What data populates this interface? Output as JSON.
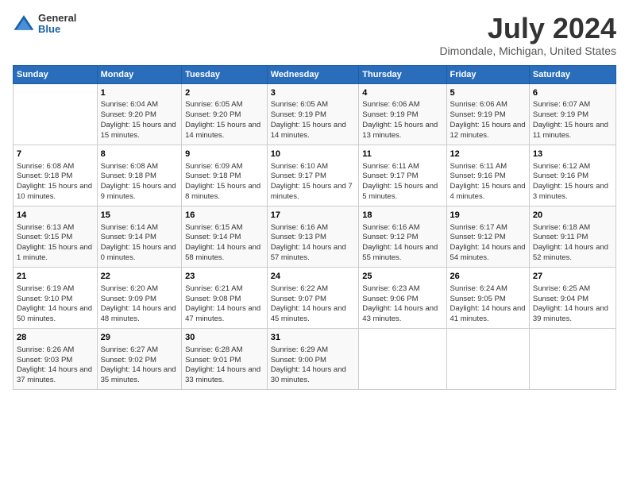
{
  "logo": {
    "general": "General",
    "blue": "Blue"
  },
  "title": "July 2024",
  "subtitle": "Dimondale, Michigan, United States",
  "days_header": [
    "Sunday",
    "Monday",
    "Tuesday",
    "Wednesday",
    "Thursday",
    "Friday",
    "Saturday"
  ],
  "weeks": [
    [
      {
        "day": "",
        "sunrise": "",
        "sunset": "",
        "daylight": ""
      },
      {
        "day": "1",
        "sunrise": "Sunrise: 6:04 AM",
        "sunset": "Sunset: 9:20 PM",
        "daylight": "Daylight: 15 hours and 15 minutes."
      },
      {
        "day": "2",
        "sunrise": "Sunrise: 6:05 AM",
        "sunset": "Sunset: 9:20 PM",
        "daylight": "Daylight: 15 hours and 14 minutes."
      },
      {
        "day": "3",
        "sunrise": "Sunrise: 6:05 AM",
        "sunset": "Sunset: 9:19 PM",
        "daylight": "Daylight: 15 hours and 14 minutes."
      },
      {
        "day": "4",
        "sunrise": "Sunrise: 6:06 AM",
        "sunset": "Sunset: 9:19 PM",
        "daylight": "Daylight: 15 hours and 13 minutes."
      },
      {
        "day": "5",
        "sunrise": "Sunrise: 6:06 AM",
        "sunset": "Sunset: 9:19 PM",
        "daylight": "Daylight: 15 hours and 12 minutes."
      },
      {
        "day": "6",
        "sunrise": "Sunrise: 6:07 AM",
        "sunset": "Sunset: 9:19 PM",
        "daylight": "Daylight: 15 hours and 11 minutes."
      }
    ],
    [
      {
        "day": "7",
        "sunrise": "Sunrise: 6:08 AM",
        "sunset": "Sunset: 9:18 PM",
        "daylight": "Daylight: 15 hours and 10 minutes."
      },
      {
        "day": "8",
        "sunrise": "Sunrise: 6:08 AM",
        "sunset": "Sunset: 9:18 PM",
        "daylight": "Daylight: 15 hours and 9 minutes."
      },
      {
        "day": "9",
        "sunrise": "Sunrise: 6:09 AM",
        "sunset": "Sunset: 9:18 PM",
        "daylight": "Daylight: 15 hours and 8 minutes."
      },
      {
        "day": "10",
        "sunrise": "Sunrise: 6:10 AM",
        "sunset": "Sunset: 9:17 PM",
        "daylight": "Daylight: 15 hours and 7 minutes."
      },
      {
        "day": "11",
        "sunrise": "Sunrise: 6:11 AM",
        "sunset": "Sunset: 9:17 PM",
        "daylight": "Daylight: 15 hours and 5 minutes."
      },
      {
        "day": "12",
        "sunrise": "Sunrise: 6:11 AM",
        "sunset": "Sunset: 9:16 PM",
        "daylight": "Daylight: 15 hours and 4 minutes."
      },
      {
        "day": "13",
        "sunrise": "Sunrise: 6:12 AM",
        "sunset": "Sunset: 9:16 PM",
        "daylight": "Daylight: 15 hours and 3 minutes."
      }
    ],
    [
      {
        "day": "14",
        "sunrise": "Sunrise: 6:13 AM",
        "sunset": "Sunset: 9:15 PM",
        "daylight": "Daylight: 15 hours and 1 minute."
      },
      {
        "day": "15",
        "sunrise": "Sunrise: 6:14 AM",
        "sunset": "Sunset: 9:14 PM",
        "daylight": "Daylight: 15 hours and 0 minutes."
      },
      {
        "day": "16",
        "sunrise": "Sunrise: 6:15 AM",
        "sunset": "Sunset: 9:14 PM",
        "daylight": "Daylight: 14 hours and 58 minutes."
      },
      {
        "day": "17",
        "sunrise": "Sunrise: 6:16 AM",
        "sunset": "Sunset: 9:13 PM",
        "daylight": "Daylight: 14 hours and 57 minutes."
      },
      {
        "day": "18",
        "sunrise": "Sunrise: 6:16 AM",
        "sunset": "Sunset: 9:12 PM",
        "daylight": "Daylight: 14 hours and 55 minutes."
      },
      {
        "day": "19",
        "sunrise": "Sunrise: 6:17 AM",
        "sunset": "Sunset: 9:12 PM",
        "daylight": "Daylight: 14 hours and 54 minutes."
      },
      {
        "day": "20",
        "sunrise": "Sunrise: 6:18 AM",
        "sunset": "Sunset: 9:11 PM",
        "daylight": "Daylight: 14 hours and 52 minutes."
      }
    ],
    [
      {
        "day": "21",
        "sunrise": "Sunrise: 6:19 AM",
        "sunset": "Sunset: 9:10 PM",
        "daylight": "Daylight: 14 hours and 50 minutes."
      },
      {
        "day": "22",
        "sunrise": "Sunrise: 6:20 AM",
        "sunset": "Sunset: 9:09 PM",
        "daylight": "Daylight: 14 hours and 48 minutes."
      },
      {
        "day": "23",
        "sunrise": "Sunrise: 6:21 AM",
        "sunset": "Sunset: 9:08 PM",
        "daylight": "Daylight: 14 hours and 47 minutes."
      },
      {
        "day": "24",
        "sunrise": "Sunrise: 6:22 AM",
        "sunset": "Sunset: 9:07 PM",
        "daylight": "Daylight: 14 hours and 45 minutes."
      },
      {
        "day": "25",
        "sunrise": "Sunrise: 6:23 AM",
        "sunset": "Sunset: 9:06 PM",
        "daylight": "Daylight: 14 hours and 43 minutes."
      },
      {
        "day": "26",
        "sunrise": "Sunrise: 6:24 AM",
        "sunset": "Sunset: 9:05 PM",
        "daylight": "Daylight: 14 hours and 41 minutes."
      },
      {
        "day": "27",
        "sunrise": "Sunrise: 6:25 AM",
        "sunset": "Sunset: 9:04 PM",
        "daylight": "Daylight: 14 hours and 39 minutes."
      }
    ],
    [
      {
        "day": "28",
        "sunrise": "Sunrise: 6:26 AM",
        "sunset": "Sunset: 9:03 PM",
        "daylight": "Daylight: 14 hours and 37 minutes."
      },
      {
        "day": "29",
        "sunrise": "Sunrise: 6:27 AM",
        "sunset": "Sunset: 9:02 PM",
        "daylight": "Daylight: 14 hours and 35 minutes."
      },
      {
        "day": "30",
        "sunrise": "Sunrise: 6:28 AM",
        "sunset": "Sunset: 9:01 PM",
        "daylight": "Daylight: 14 hours and 33 minutes."
      },
      {
        "day": "31",
        "sunrise": "Sunrise: 6:29 AM",
        "sunset": "Sunset: 9:00 PM",
        "daylight": "Daylight: 14 hours and 30 minutes."
      },
      {
        "day": "",
        "sunrise": "",
        "sunset": "",
        "daylight": ""
      },
      {
        "day": "",
        "sunrise": "",
        "sunset": "",
        "daylight": ""
      },
      {
        "day": "",
        "sunrise": "",
        "sunset": "",
        "daylight": ""
      }
    ]
  ]
}
